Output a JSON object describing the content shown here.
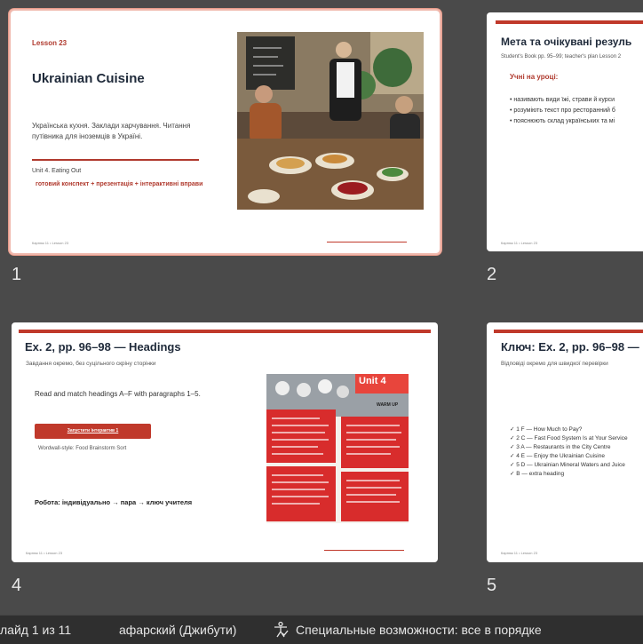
{
  "slides": [
    {
      "number": "1",
      "selected": true,
      "lesson_label": "Lesson 23",
      "title": "Ukrainian Cuisine",
      "subtitle": "Українська кухня. Заклади харчування. Читання путівника для іноземців в Україні.",
      "unit": "Unit 4. Eating Out",
      "tagline": "готовий конспект + презентація + інтерактивні вправи",
      "footer": "Карпюк 11 • Lesson 23",
      "photo": "restaurant-waiter-serving-photo"
    },
    {
      "number": "2",
      "title": "Мета та очікувані резуль",
      "source": "Student's Book pp. 95–99; teacher's plan Lesson 2",
      "heading": "Учні на уроці:",
      "items": [
        "• називають види їжі, страви й курси",
        "• розуміють текст про ресторанний б",
        "• пояснюють склад українських та мі"
      ],
      "footer": "Карпюк 11 • Lesson 23"
    },
    {
      "number": "4",
      "title": "Ex. 2, pp. 96–98 — Headings",
      "subtitle": "Завдання окремо, без суцільного скріну сторінки",
      "instruction": "Read and match headings A–F with paragraphs 1–5.",
      "button_label": "Запустити інтерактив 1",
      "caption": "Wordwall-style: Food Brainstorm Sort",
      "work_mode": "Робота: індивідуально → пара → ключ учителя",
      "image_badge": "Unit 4",
      "image_subtitle": "WARM UP",
      "footer": "Карпюк 11 • Lesson 23"
    },
    {
      "number": "5",
      "title": "Ключ: Ex. 2, pp. 96–98 —",
      "subtitle": "Відповіді окремо для швидкої перевірки",
      "answers": [
        "✓ 1 F — How Much to Pay?",
        "✓ 2 C — Fast Food System Is at Your Service",
        "✓ 3 A — Restaurants in the City Centre",
        "✓ 4 E — Enjoy the Ukrainian Cuisine",
        "✓ 5 D — Ukrainian Mineral Waters and Juice",
        "✓ B — extra heading"
      ],
      "footer": "Карпюк 11 • Lesson 23"
    }
  ],
  "statusbar": {
    "slide_counter": "лайд 1 из 11",
    "language": "афарский (Джибути)",
    "accessibility": "Специальные возможности: все в порядке"
  },
  "colors": {
    "accent": "#c0392b",
    "workspace_bg": "#4a4a4a",
    "statusbar_bg": "#2f2f2f",
    "title": "#1f2a3a",
    "selection": "#e59a8a"
  }
}
